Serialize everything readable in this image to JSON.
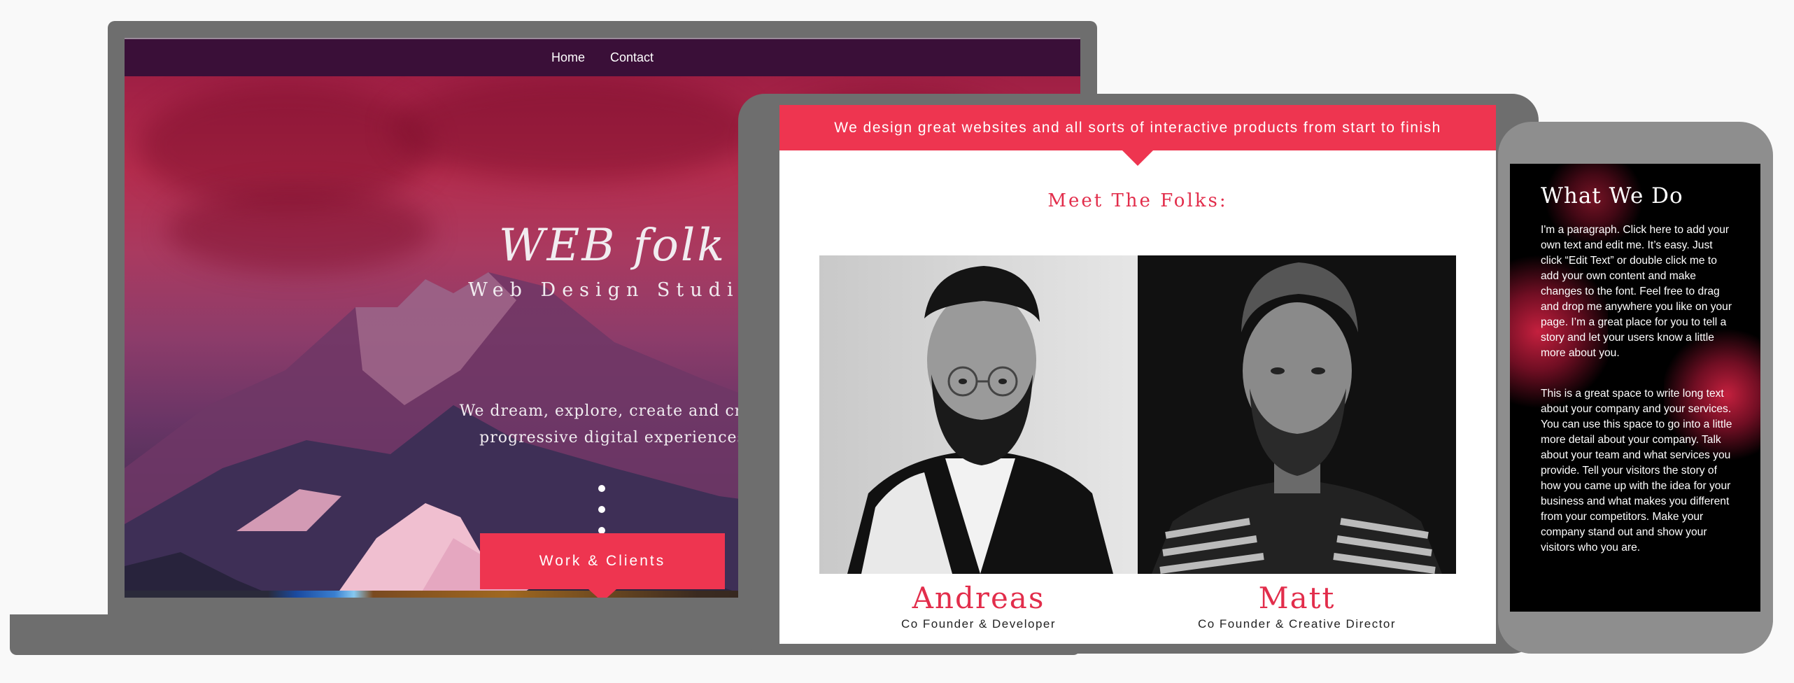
{
  "laptop": {
    "nav": [
      "Home",
      "Contact"
    ],
    "hero_title": "WEB folk",
    "hero_subtitle": "Web Design Studio",
    "tagline_line1": "We dream, explore, create and craft",
    "tagline_line2": "progressive digital experiences",
    "cta_label": "Work & Clients"
  },
  "tablet": {
    "banner": "We design great websites and all sorts of interactive products from start to finish",
    "section_title": "Meet The Folks:",
    "people": [
      {
        "name": "Andreas",
        "role": "Co Founder & Developer"
      },
      {
        "name": "Matt",
        "role": "Co Founder & Creative Director"
      }
    ]
  },
  "phone": {
    "title": "What We Do",
    "paragraph1": "I'm a paragraph. Click here to add your own text and edit me. It’s easy. Just click “Edit Text” or double click me to add your own content and make changes to the font. Feel free to drag and drop me anywhere you like on your page. I’m a great place for you to tell a story and let your users know a little more about you.",
    "paragraph2": "This is a great space to write long text about your company and your services. You can use this space to go into a little more detail about your company. Talk about your team and what services you provide. Tell your visitors the story of how you came up with the idea for your business and what makes you different from your competitors. Make your company stand out and show your visitors who you are."
  },
  "colors": {
    "accent": "#ee3550",
    "accent_text": "#e22d4b",
    "device_frame": "#6e6e6e",
    "nav_bg": "#3a0f38"
  }
}
